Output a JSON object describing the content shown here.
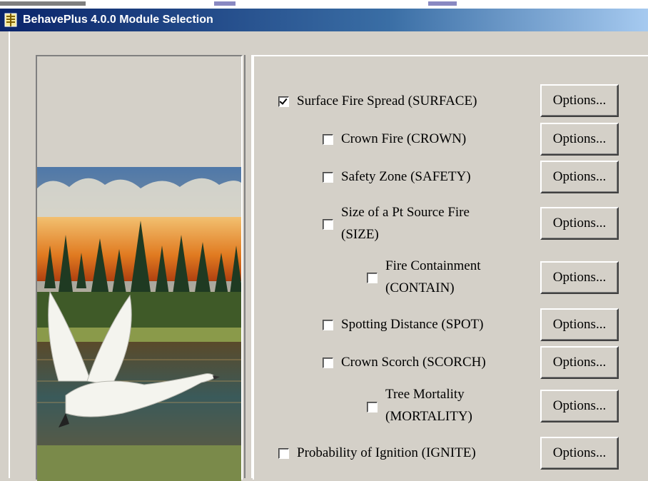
{
  "window": {
    "title": "BehavePlus 4.0.0 Module Selection"
  },
  "modules": [
    {
      "label": "Surface Fire Spread (SURFACE)",
      "checked": true,
      "button": "Options..."
    },
    {
      "label": "Crown Fire (CROWN)",
      "checked": false,
      "button": "Options..."
    },
    {
      "label": "Safety Zone (SAFETY)",
      "checked": false,
      "button": "Options..."
    },
    {
      "label_line1": "Size of a Pt Source Fire",
      "label_line2": "(SIZE)",
      "checked": false,
      "button": "Options..."
    },
    {
      "label_line1": "Fire Containment",
      "label_line2": "(CONTAIN)",
      "checked": false,
      "button": "Options..."
    },
    {
      "label": "Spotting Distance (SPOT)",
      "checked": false,
      "button": "Options..."
    },
    {
      "label": "Crown Scorch (SCORCH)",
      "checked": false,
      "button": "Options..."
    },
    {
      "label_line1": "Tree Mortality",
      "label_line2": "(MORTALITY)",
      "checked": false,
      "button": "Options..."
    },
    {
      "label": "Probability of Ignition (IGNITE)",
      "checked": false,
      "button": "Options..."
    }
  ],
  "icons": {
    "app": "app-window-icon",
    "illustration": "swan-wildfire-illustration"
  }
}
